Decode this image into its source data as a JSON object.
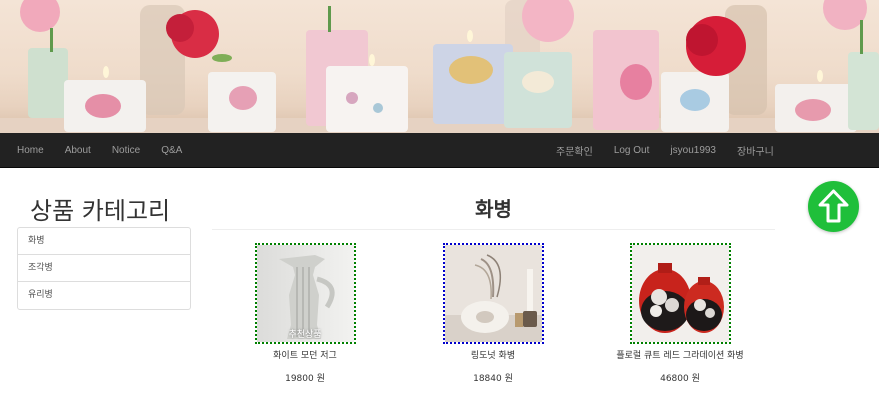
{
  "navbar": {
    "left": [
      {
        "label": "Home"
      },
      {
        "label": "About"
      },
      {
        "label": "Notice"
      },
      {
        "label": "Q&A"
      }
    ],
    "right": [
      {
        "label": "주문확인"
      },
      {
        "label": "Log Out"
      },
      {
        "label": "jsyou1993"
      },
      {
        "label": "장바구니"
      }
    ]
  },
  "sidebar": {
    "title": "상품 카테고리",
    "items": [
      {
        "label": "화병"
      },
      {
        "label": "조각병"
      },
      {
        "label": "유리병"
      }
    ]
  },
  "main": {
    "title": "화병",
    "products": [
      {
        "name": "화이트 모던 저그",
        "price": "19800 원",
        "badge": "추천상품",
        "selected": false
      },
      {
        "name": "링도넛 화병",
        "price": "18840 원",
        "selected": true
      },
      {
        "name": "플로럴 큐트 레드 그라데이션 화병",
        "price": "46800 원",
        "selected": false
      }
    ]
  },
  "colors": {
    "navbar_bg": "#222222",
    "nav_text": "#9d9d9d",
    "thumb_border": "#008000",
    "thumb_border_selected": "#0000cc",
    "top_button": "#1fbf3a"
  },
  "icons": {
    "scroll_top": "arrow-up-icon"
  }
}
